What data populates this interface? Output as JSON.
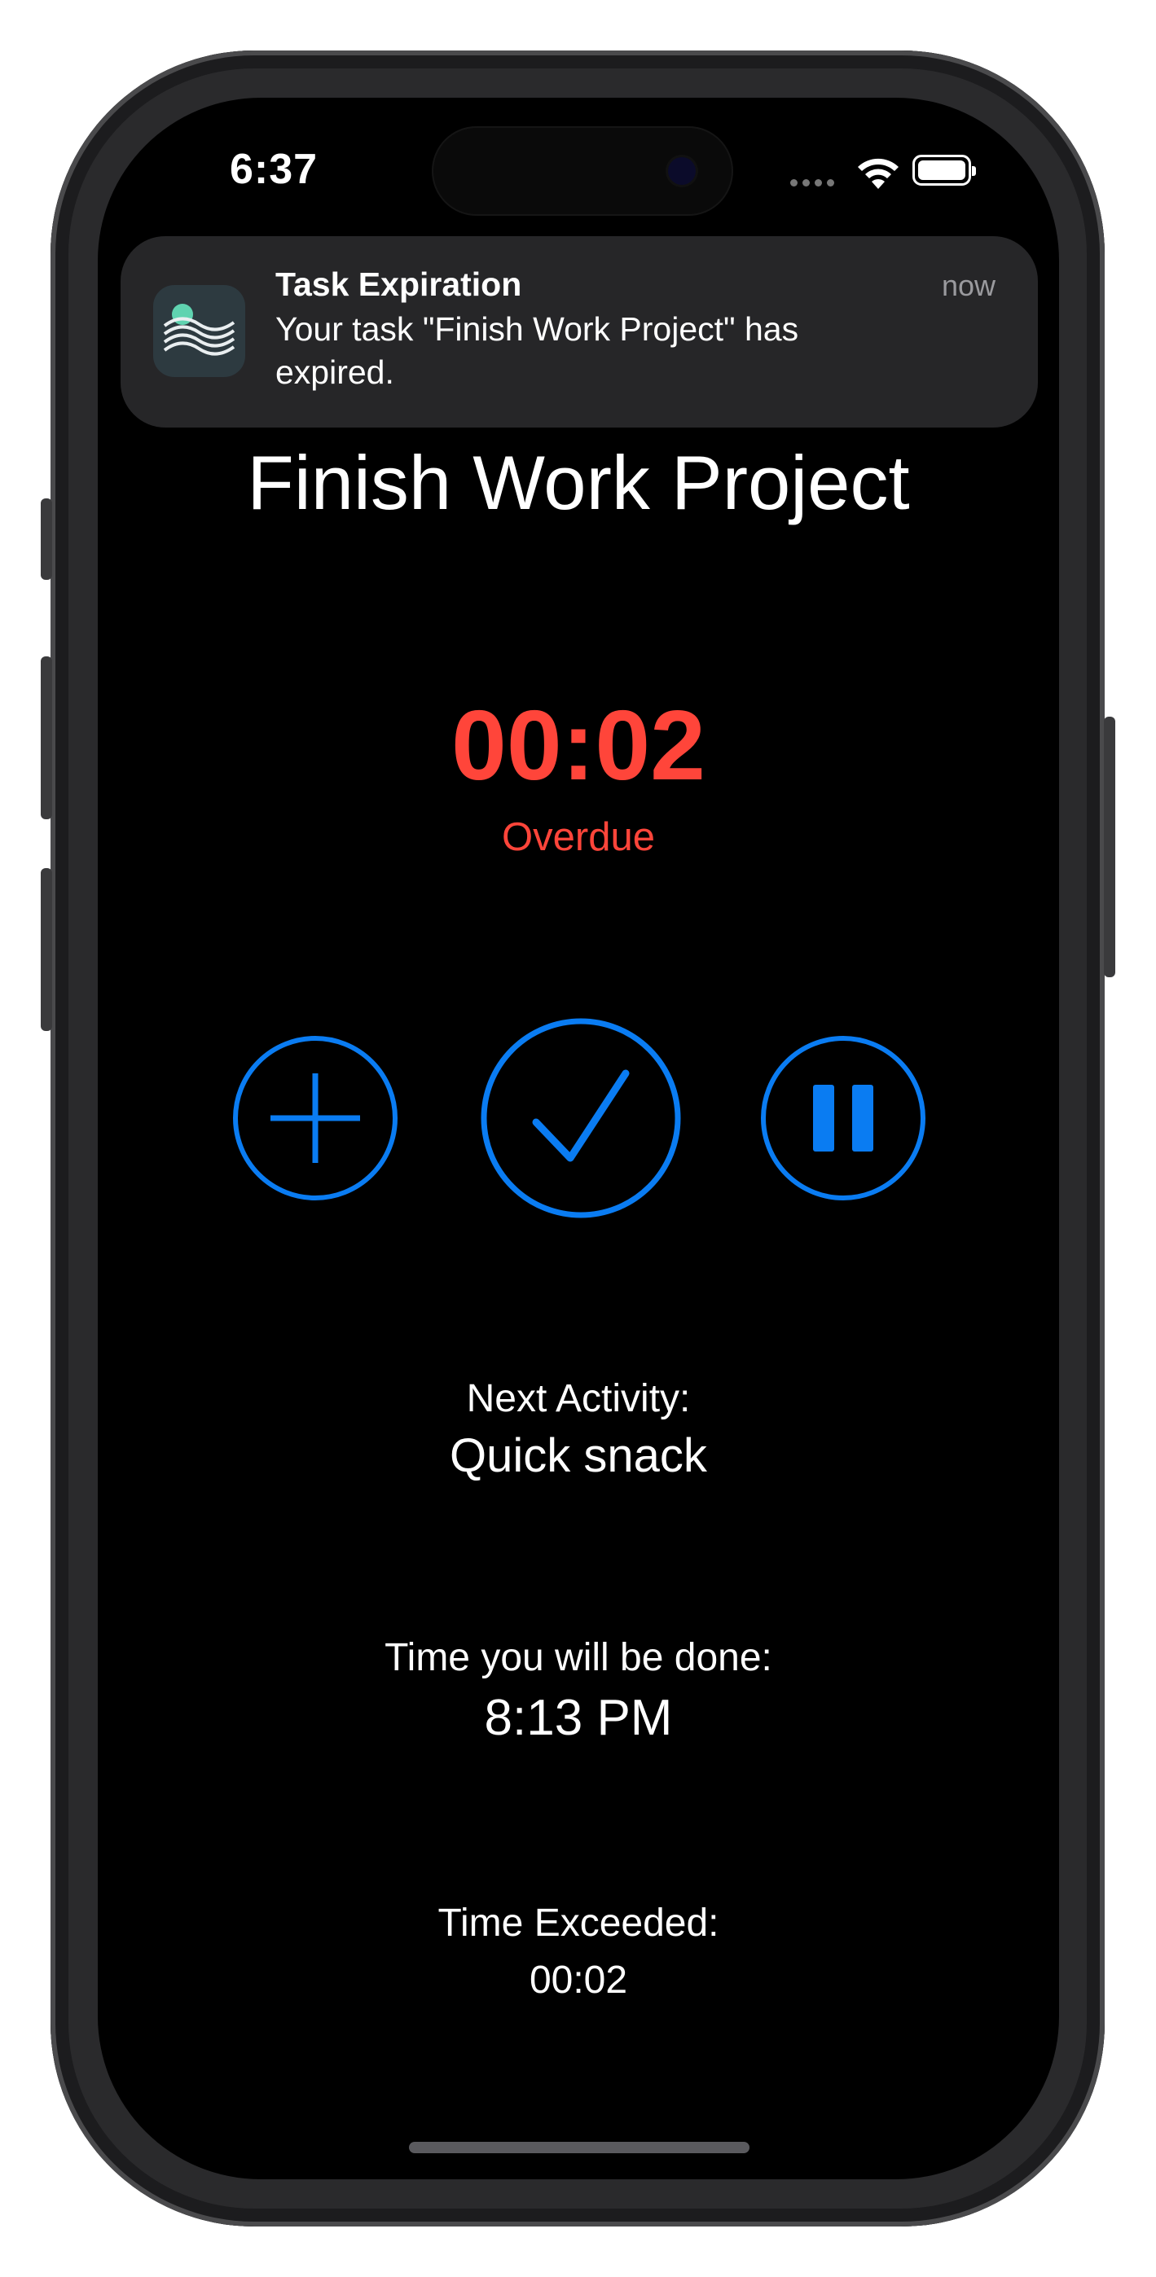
{
  "status_bar": {
    "time": "6:37"
  },
  "notification": {
    "title": "Task Expiration",
    "body": "Your task \"Finish Work Project\" has expired.",
    "time": "now"
  },
  "task": {
    "title": "Finish Work Project",
    "timer": "00:02",
    "status": "Overdue"
  },
  "controls": {
    "add_icon": "plus-icon",
    "complete_icon": "checkmark-icon",
    "pause_icon": "pause-icon",
    "accent_color": "#0a7cf2"
  },
  "info": {
    "next_activity_label": "Next Activity:",
    "next_activity_value": "Quick snack",
    "done_time_label": "Time you will be done:",
    "done_time_value": "8:13 PM",
    "exceeded_label": "Time Exceeded:",
    "exceeded_value": "00:02"
  },
  "colors": {
    "overdue": "#ff453a",
    "background": "#000000"
  }
}
